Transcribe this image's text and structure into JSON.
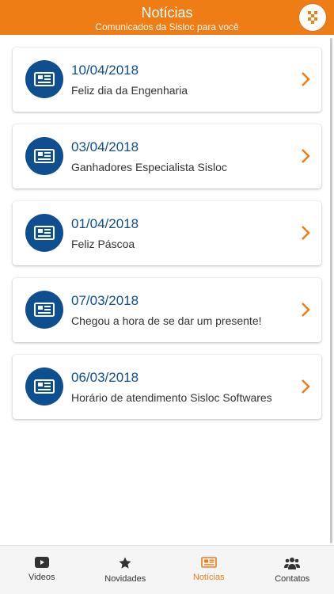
{
  "header": {
    "title": "Notícias",
    "subtitle": "Comunicados da Sisloc para você",
    "menu_icon": "qr-grid-icon",
    "color": "#ef7d16"
  },
  "news": [
    {
      "date": "10/04/2018",
      "headline": "Feliz dia da Engenharia"
    },
    {
      "date": "03/04/2018",
      "headline": "Ganhadores Especialista Sisloc"
    },
    {
      "date": "01/04/2018",
      "headline": "Feliz Páscoa"
    },
    {
      "date": "07/03/2018",
      "headline": "Chegou a hora de se dar um presente!"
    },
    {
      "date": "06/03/2018",
      "headline": "Horário de atendimento Sisloc Softwares"
    }
  ],
  "tabs": [
    {
      "label": "Videos",
      "icon": "video-play-icon",
      "active": false
    },
    {
      "label": "Novidades",
      "icon": "star-icon",
      "active": false
    },
    {
      "label": "Notícias",
      "icon": "newspaper-icon",
      "active": true
    },
    {
      "label": "Contatos",
      "icon": "people-icon",
      "active": false
    }
  ],
  "colors": {
    "accent": "#ef7d16",
    "brand_blue": "#0f4f8f"
  }
}
